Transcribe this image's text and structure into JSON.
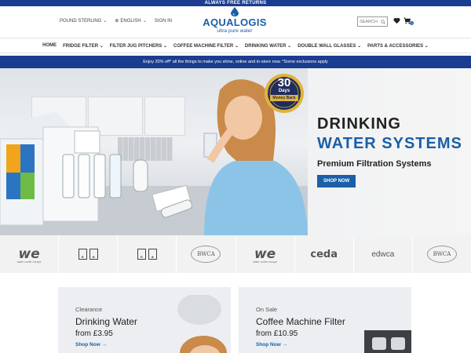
{
  "topbar": {
    "text": "ALWAYS FREE RETURNS"
  },
  "header": {
    "currency": "POUND STERLING",
    "language": "ENGLISH",
    "signin": "SIGN IN",
    "logo_name": "AQUALOGIS",
    "logo_tag": "ultra pure water",
    "search_placeholder": "SEARCH",
    "cart_count": "0"
  },
  "nav": {
    "items": [
      "HOME",
      "FRIDGE FILTER",
      "FILTER JUG PITCHERS",
      "COFFEE MACHINE FILTER",
      "DRINKING WATER",
      "DOUBLE WALL GLASSES",
      "PARTS & ACCESSORIES"
    ]
  },
  "promo": {
    "text": "Enjoy 20% off* all the things to make you shine, online and in-store now. *Some exclusions apply"
  },
  "hero": {
    "title_line1": "DRINKING",
    "title_line2": "WATER SYSTEMS",
    "subtitle": "Premium Filtration Systems",
    "button": "SHOP NOW",
    "badge_number": "30",
    "badge_days": "Days",
    "badge_text": "Money Back"
  },
  "partners": [
    "we",
    "ISO",
    "ISO",
    "BWCA",
    "we",
    "ceda",
    "edwca",
    "BWCA"
  ],
  "cards": [
    {
      "kicker": "Clearance",
      "title": "Drinking Water",
      "price": "from £3.95",
      "link": "Shop Now →"
    },
    {
      "kicker": "On Sale",
      "title": "Coffee Machine Filter",
      "price": "from £10.95",
      "link": "Shop Now →"
    }
  ],
  "colors": {
    "brand_blue": "#1a5fa8",
    "navy": "#1a3d8f"
  }
}
